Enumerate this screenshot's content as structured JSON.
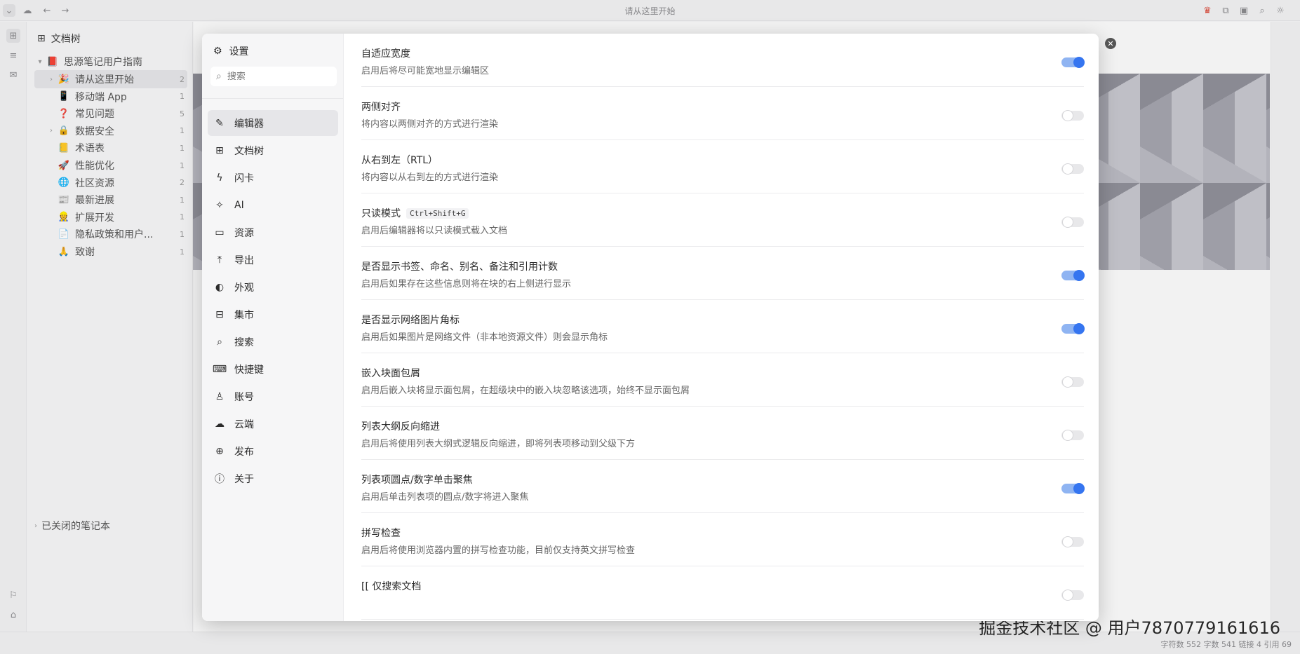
{
  "topbar": {
    "title": "请从这里开始"
  },
  "tree": {
    "header": "文档树",
    "notebook": "思源笔记用户指南",
    "items": [
      {
        "label": "请从这里开始",
        "count": "2",
        "emoji": "🎉",
        "expandable": true,
        "active": true
      },
      {
        "label": "移动端 App",
        "count": "1",
        "emoji": "📱",
        "expandable": false
      },
      {
        "label": "常见问题",
        "count": "5",
        "emoji": "❓",
        "expandable": false
      },
      {
        "label": "数据安全",
        "count": "1",
        "emoji": "🔒",
        "expandable": true
      },
      {
        "label": "术语表",
        "count": "1",
        "emoji": "📒",
        "expandable": false
      },
      {
        "label": "性能优化",
        "count": "1",
        "emoji": "🚀",
        "expandable": false
      },
      {
        "label": "社区资源",
        "count": "2",
        "emoji": "🌐",
        "expandable": false
      },
      {
        "label": "最新进展",
        "count": "1",
        "emoji": "📰",
        "expandable": false
      },
      {
        "label": "扩展开发",
        "count": "1",
        "emoji": "👷",
        "expandable": false
      },
      {
        "label": "隐私政策和用户...",
        "count": "1",
        "emoji": "📄",
        "expandable": false
      },
      {
        "label": "致谢",
        "count": "1",
        "emoji": "🙏",
        "expandable": false
      }
    ],
    "closed_notebooks": "已关闭的笔记本"
  },
  "dialog": {
    "title": "设置",
    "search_placeholder": "搜索",
    "nav": [
      {
        "label": "编辑器",
        "icon": "✎",
        "active": true
      },
      {
        "label": "文档树",
        "icon": "⊞"
      },
      {
        "label": "闪卡",
        "icon": "ϟ"
      },
      {
        "label": "AI",
        "icon": "✧"
      },
      {
        "label": "资源",
        "icon": "▭"
      },
      {
        "label": "导出",
        "icon": "⤒"
      },
      {
        "label": "外观",
        "icon": "◐"
      },
      {
        "label": "集市",
        "icon": "⊟"
      },
      {
        "label": "搜索",
        "icon": "⌕"
      },
      {
        "label": "快捷键",
        "icon": "⌨"
      },
      {
        "label": "账号",
        "icon": "♙"
      },
      {
        "label": "云端",
        "icon": "☁"
      },
      {
        "label": "发布",
        "icon": "⊕"
      },
      {
        "label": "关于",
        "icon": "ⓘ"
      }
    ],
    "settings": [
      {
        "title": "自适应宽度",
        "desc": "启用后将尽可能宽地显示编辑区",
        "on": true
      },
      {
        "title": "两侧对齐",
        "desc": "将内容以两侧对齐的方式进行渲染",
        "on": false
      },
      {
        "title": "从右到左（RTL）",
        "desc": "将内容以从右到左的方式进行渲染",
        "on": false
      },
      {
        "title": "只读模式",
        "kbd": "Ctrl+Shift+G",
        "desc": "启用后编辑器将以只读模式载入文档",
        "on": false
      },
      {
        "title": "是否显示书签、命名、别名、备注和引用计数",
        "desc": "启用后如果存在这些信息则将在块的右上侧进行显示",
        "on": true
      },
      {
        "title": "是否显示网络图片角标",
        "desc": "启用后如果图片是网络文件（非本地资源文件）则会显示角标",
        "on": true
      },
      {
        "title": "嵌入块面包屑",
        "desc": "启用后嵌入块将显示面包屑，在超级块中的嵌入块忽略该选项，始终不显示面包屑",
        "on": false
      },
      {
        "title": "列表大纲反向缩进",
        "desc": "启用后将使用列表大纲式逻辑反向缩进，即将列表项移动到父级下方",
        "on": false
      },
      {
        "title": "列表项圆点/数字单击聚焦",
        "desc": "启用后单击列表项的圆点/数字将进入聚焦",
        "on": true
      },
      {
        "title": "拼写检查",
        "desc": "启用后将使用浏览器内置的拼写检查功能，目前仅支持英文拼写检查",
        "on": false
      },
      {
        "title": "[[ 仅搜索文档",
        "desc": "",
        "on": false
      }
    ]
  },
  "status": {
    "text": "字符数 552  字数 541  链接 4  引用 69"
  },
  "watermark": "掘金技术社区 @ 用户7870779161616"
}
